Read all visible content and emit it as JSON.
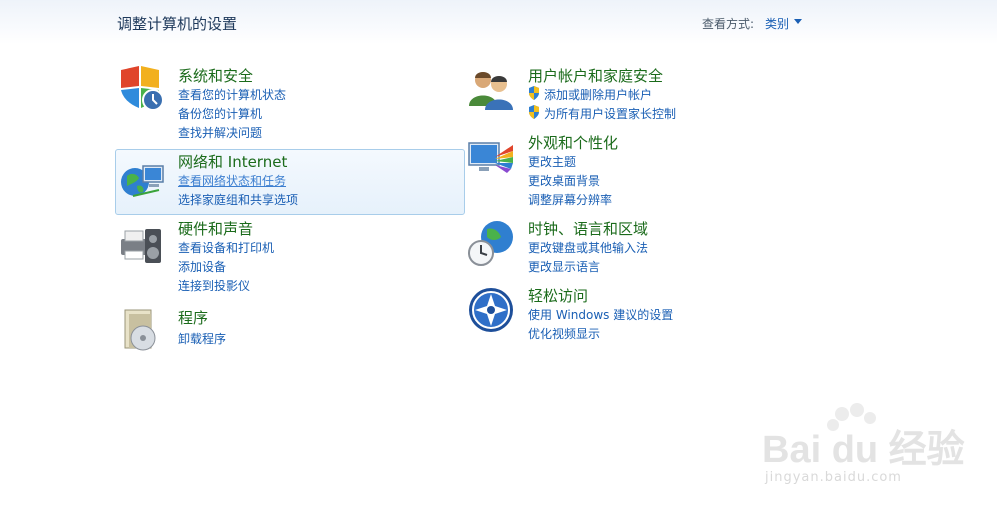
{
  "header": {
    "title": "调整计算机的设置",
    "view_by_label": "查看方式:",
    "view_by_value": "类别"
  },
  "categories": [
    {
      "title": "系统和安全",
      "icon": "shield-computer-icon",
      "links": [
        "查看您的计算机状态",
        "备份您的计算机",
        "查找并解决问题"
      ]
    },
    {
      "title": "网络和 Internet",
      "icon": "network-globe-icon",
      "links": [
        "查看网络状态和任务",
        "选择家庭组和共享选项"
      ]
    },
    {
      "title": "硬件和声音",
      "icon": "printer-speaker-icon",
      "links": [
        "查看设备和打印机",
        "添加设备",
        "连接到投影仪"
      ]
    },
    {
      "title": "程序",
      "icon": "programs-box-icon",
      "links": [
        "卸载程序"
      ]
    },
    {
      "title": "用户帐户和家庭安全",
      "icon": "users-icon",
      "links": [
        "添加或删除用户帐户",
        "为所有用户设置家长控制"
      ]
    },
    {
      "title": "外观和个性化",
      "icon": "monitor-palette-icon",
      "links": [
        "更改主题",
        "更改桌面背景",
        "调整屏幕分辨率"
      ]
    },
    {
      "title": "时钟、语言和区域",
      "icon": "clock-globe-icon",
      "links": [
        "更改键盘或其他输入法",
        "更改显示语言"
      ]
    },
    {
      "title": "轻松访问",
      "icon": "ease-of-access-icon",
      "links": [
        "使用 Windows 建议的设置",
        "优化视频显示"
      ]
    }
  ],
  "watermark": {
    "brand": "Bai du 经验",
    "url": "jingyan.baidu.com"
  },
  "colors": {
    "category_title": "#1b6b1b",
    "link": "#1a5fb4",
    "title": "#1e395b"
  }
}
